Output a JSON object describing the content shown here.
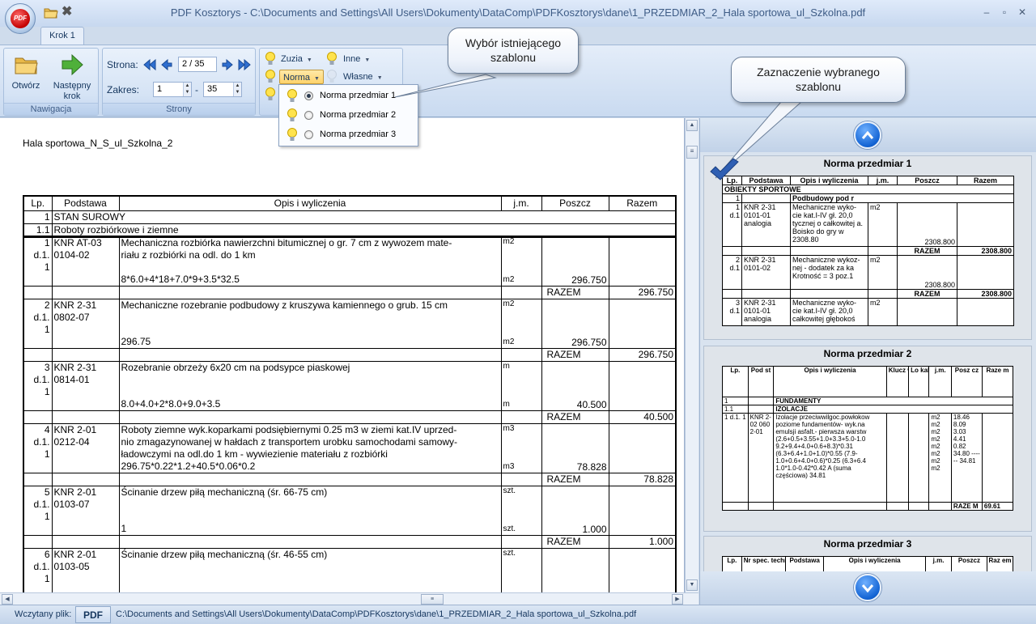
{
  "window": {
    "title": "PDF Kosztorys - C:\\Documents and Settings\\All Users\\Dokumenty\\DataComp\\PDFKosztorys\\dane\\1_PRZEDMIAR_2_Hala sportowa_ul_Szkolna.pdf",
    "logo_text": "PDF"
  },
  "ribbon": {
    "tab": "Krok 1",
    "nawigacja": {
      "label": "Nawigacja",
      "open": "Otwórz",
      "next_line1": "Następny",
      "next_line2": "krok"
    },
    "strony": {
      "label": "Strony",
      "strona_label": "Strona:",
      "page_value": "2 / 35",
      "zakres_label": "Zakres:",
      "range_from": "1",
      "range_sep": "-",
      "range_to": "35"
    },
    "templates": {
      "zuzia": "Zuzia",
      "inne": "Inne",
      "norma": "Norma",
      "wlasne": "Własne"
    }
  },
  "dropdown": {
    "items": [
      {
        "label": "Norma przedmiar 1",
        "selected": true
      },
      {
        "label": "Norma przedmiar 2",
        "selected": false
      },
      {
        "label": "Norma przedmiar 3",
        "selected": false
      }
    ]
  },
  "callouts": {
    "existing_line1": "Wybór istniejącego",
    "existing_line2": "szablonu",
    "selected_line1": "Zaznaczenie wybranego",
    "selected_line2": "szablonu"
  },
  "document": {
    "header": "Hala sportowa_N_S_ul_Szkolna_2",
    "header_right": "...",
    "columns": [
      "Lp.",
      "Podstawa",
      "Opis i wyliczenia",
      "j.m.",
      "Poszcz",
      "Razem"
    ],
    "rows": [
      {
        "lp": "1",
        "text": "STAN SUROWY"
      },
      {
        "lp": "1.1",
        "text": "Roboty rozbiórkowe i ziemne"
      },
      {
        "lp1": "1",
        "lp2": "d.1.",
        "lp3": "1",
        "code1": "KNR AT-03",
        "code2": "0104-02",
        "desc": [
          "Mechaniczna rozbiórka nawierzchni bitumicznej o gr. 7 cm z wywozem mate-",
          "riału z rozbiórki na odl. do 1 km",
          "",
          "8*6.0+4*18+7.0*9+3.5*32.5"
        ],
        "jm": "m2",
        "jm2": "m2",
        "poszcz": "296.750",
        "razem_label": "RAZEM",
        "razem": "296.750"
      },
      {
        "lp1": "2",
        "lp2": "d.1.",
        "lp3": "1",
        "code1": "KNR 2-31",
        "code2": "0802-07",
        "desc": [
          "Mechaniczne rozebranie podbudowy z kruszywa kamiennego o grub. 15 cm",
          "",
          "",
          "296.75"
        ],
        "jm": "m2",
        "jm2": "m2",
        "poszcz": "296.750",
        "razem_label": "RAZEM",
        "razem": "296.750"
      },
      {
        "lp1": "3",
        "lp2": "d.1.",
        "lp3": "1",
        "code1": "KNR 2-31",
        "code2": "0814-01",
        "desc": [
          "Rozebranie obrzeży 6x20 cm na podsypce piaskowej",
          "",
          "",
          "8.0+4.0+2*8.0+9.0+3.5"
        ],
        "jm": "m",
        "jm2": "m",
        "poszcz": "40.500",
        "razem_label": "RAZEM",
        "razem": "40.500"
      },
      {
        "lp1": "4",
        "lp2": "d.1.",
        "lp3": "1",
        "code1": "KNR 2-01",
        "code2": "0212-04",
        "desc": [
          "Roboty ziemne wyk.koparkami podsiębiernymi 0.25 m3 w ziemi kat.IV uprzed-",
          "nio zmagazynowanej w hałdach z transportem urobku samochodami samowy-",
          "ładowczymi na odl.do 1 km - wywiezienie materiału z rozbiórki",
          "296.75*0.22*1.2+40.5*0.06*0.2"
        ],
        "jm": "m3",
        "jm2": "m3",
        "poszcz": "78.828",
        "razem_label": "RAZEM",
        "razem": "78.828"
      },
      {
        "lp1": "5",
        "lp2": "d.1.",
        "lp3": "1",
        "code1": "KNR 2-01",
        "code2": "0103-07",
        "desc": [
          "Ścinanie drzew piłą mechaniczną (śr. 66-75 cm)",
          "",
          "",
          "1"
        ],
        "jm": "szt.",
        "jm2": "szt.",
        "poszcz": "1.000",
        "razem_label": "RAZEM",
        "razem": "1.000"
      },
      {
        "lp1": "6",
        "lp2": "d.1.",
        "lp3": "1",
        "code1": "KNR 2-01",
        "code2": "0103-05",
        "desc": [
          "Ścinanie drzew piłą mechaniczną (śr. 46-55 cm)",
          "",
          "",
          ""
        ],
        "jm": "szt.",
        "jm2": "",
        "poszcz": "",
        "razem_label": "",
        "razem": ""
      }
    ]
  },
  "preview": {
    "card1": {
      "title": "Norma przedmiar 1",
      "cols": [
        "Lp.",
        "Podstawa",
        "Opis i wyliczenia",
        "j.m.",
        "Poszcz",
        "Razem"
      ],
      "section": "OBIEKTY SPORTOWE",
      "sub_lp": "1",
      "sub_text": "Podbudowy pod r",
      "r1": {
        "lp": "1 d.1",
        "code": "KNR 2-31 0101-01 analogia",
        "desc": "Mechaniczne wyko- cie kat.I-IV gł. 20,0 tycznej o całkowitej a. Boisko do gry w 2308.80",
        "jm": "m2",
        "jm2": "m2",
        "poszcz": "2308.800",
        "razem_label": "RAZEM",
        "razem": "2308.800"
      },
      "r2": {
        "lp": "2 d.1",
        "code": "KNR 2-31 0101-02",
        "desc": "Mechaniczne wykoz- nej - dodatek za ka Krotność = 3 poz.1",
        "jm": "m2",
        "poszcz": "2308.800",
        "razem_label": "RAZEM",
        "razem": "2308.800"
      },
      "r3": {
        "lp": "3 d.1",
        "code": "KNR 2-31 0101-01 analogia",
        "desc": "Mechaniczne wyko- cie kat.I-IV gł. 20,0 całkowitej głębokoś",
        "jm": "m2"
      }
    },
    "card2": {
      "title": "Norma przedmiar 2",
      "cols": [
        "Lp.",
        "Pod st",
        "Opis i wyliczenia",
        "Klucz wyko nawc zy",
        "Lo kal iza cja",
        "j.m.",
        "Posz cz",
        "Raze m"
      ],
      "s1_lp": "1",
      "s1": "FUNDAMENTY",
      "s2_lp": "1.1",
      "s2": "IZOLACJE",
      "r_lp": "1 d.1. 1",
      "r_code": "KNR 2-02 060 2-01",
      "r_desc": "Izolacje przeciwwilgoc.powłokow poziome fundamentów- wyk.na emulsji asfalt.- pierwsza warstw (2.6+0.5+3.55+1.0+3.3+5.0-1.0 9.2+9.4+4.0+0.6+8.3)*0.31 (6.3+6.4+1.0+1.0)*0.55 (7.9- 1.0+0.6+4.0+0.6)*0.25 (6.3+6.4 1.0*1.0-0.42*0.42 A (suma częściowa) 34.81",
      "r_jm": "m2 m2 m2 m2 m2 m2 m2 m2",
      "r_poszcz": "18.46 8.09 3.03 4.41 0.82 34.80 ------ 34.81",
      "razem_label": "RAZE M",
      "razem": "69.61"
    },
    "card3": {
      "title": "Norma przedmiar 3",
      "cols": [
        "Lp.",
        "Nr spec. techn.",
        "Podstawa",
        "Opis i wyliczenia",
        "j.m.",
        "Poszcz",
        "Raz em"
      ]
    }
  },
  "statusbar": {
    "label": "Wczytany plik:",
    "pdf": "PDF",
    "path": "C:\\Documents and Settings\\All Users\\Dokumenty\\DataComp\\PDFKosztorys\\dane\\1_PRZEDMIAR_2_Hala sportowa_ul_Szkolna.pdf"
  }
}
